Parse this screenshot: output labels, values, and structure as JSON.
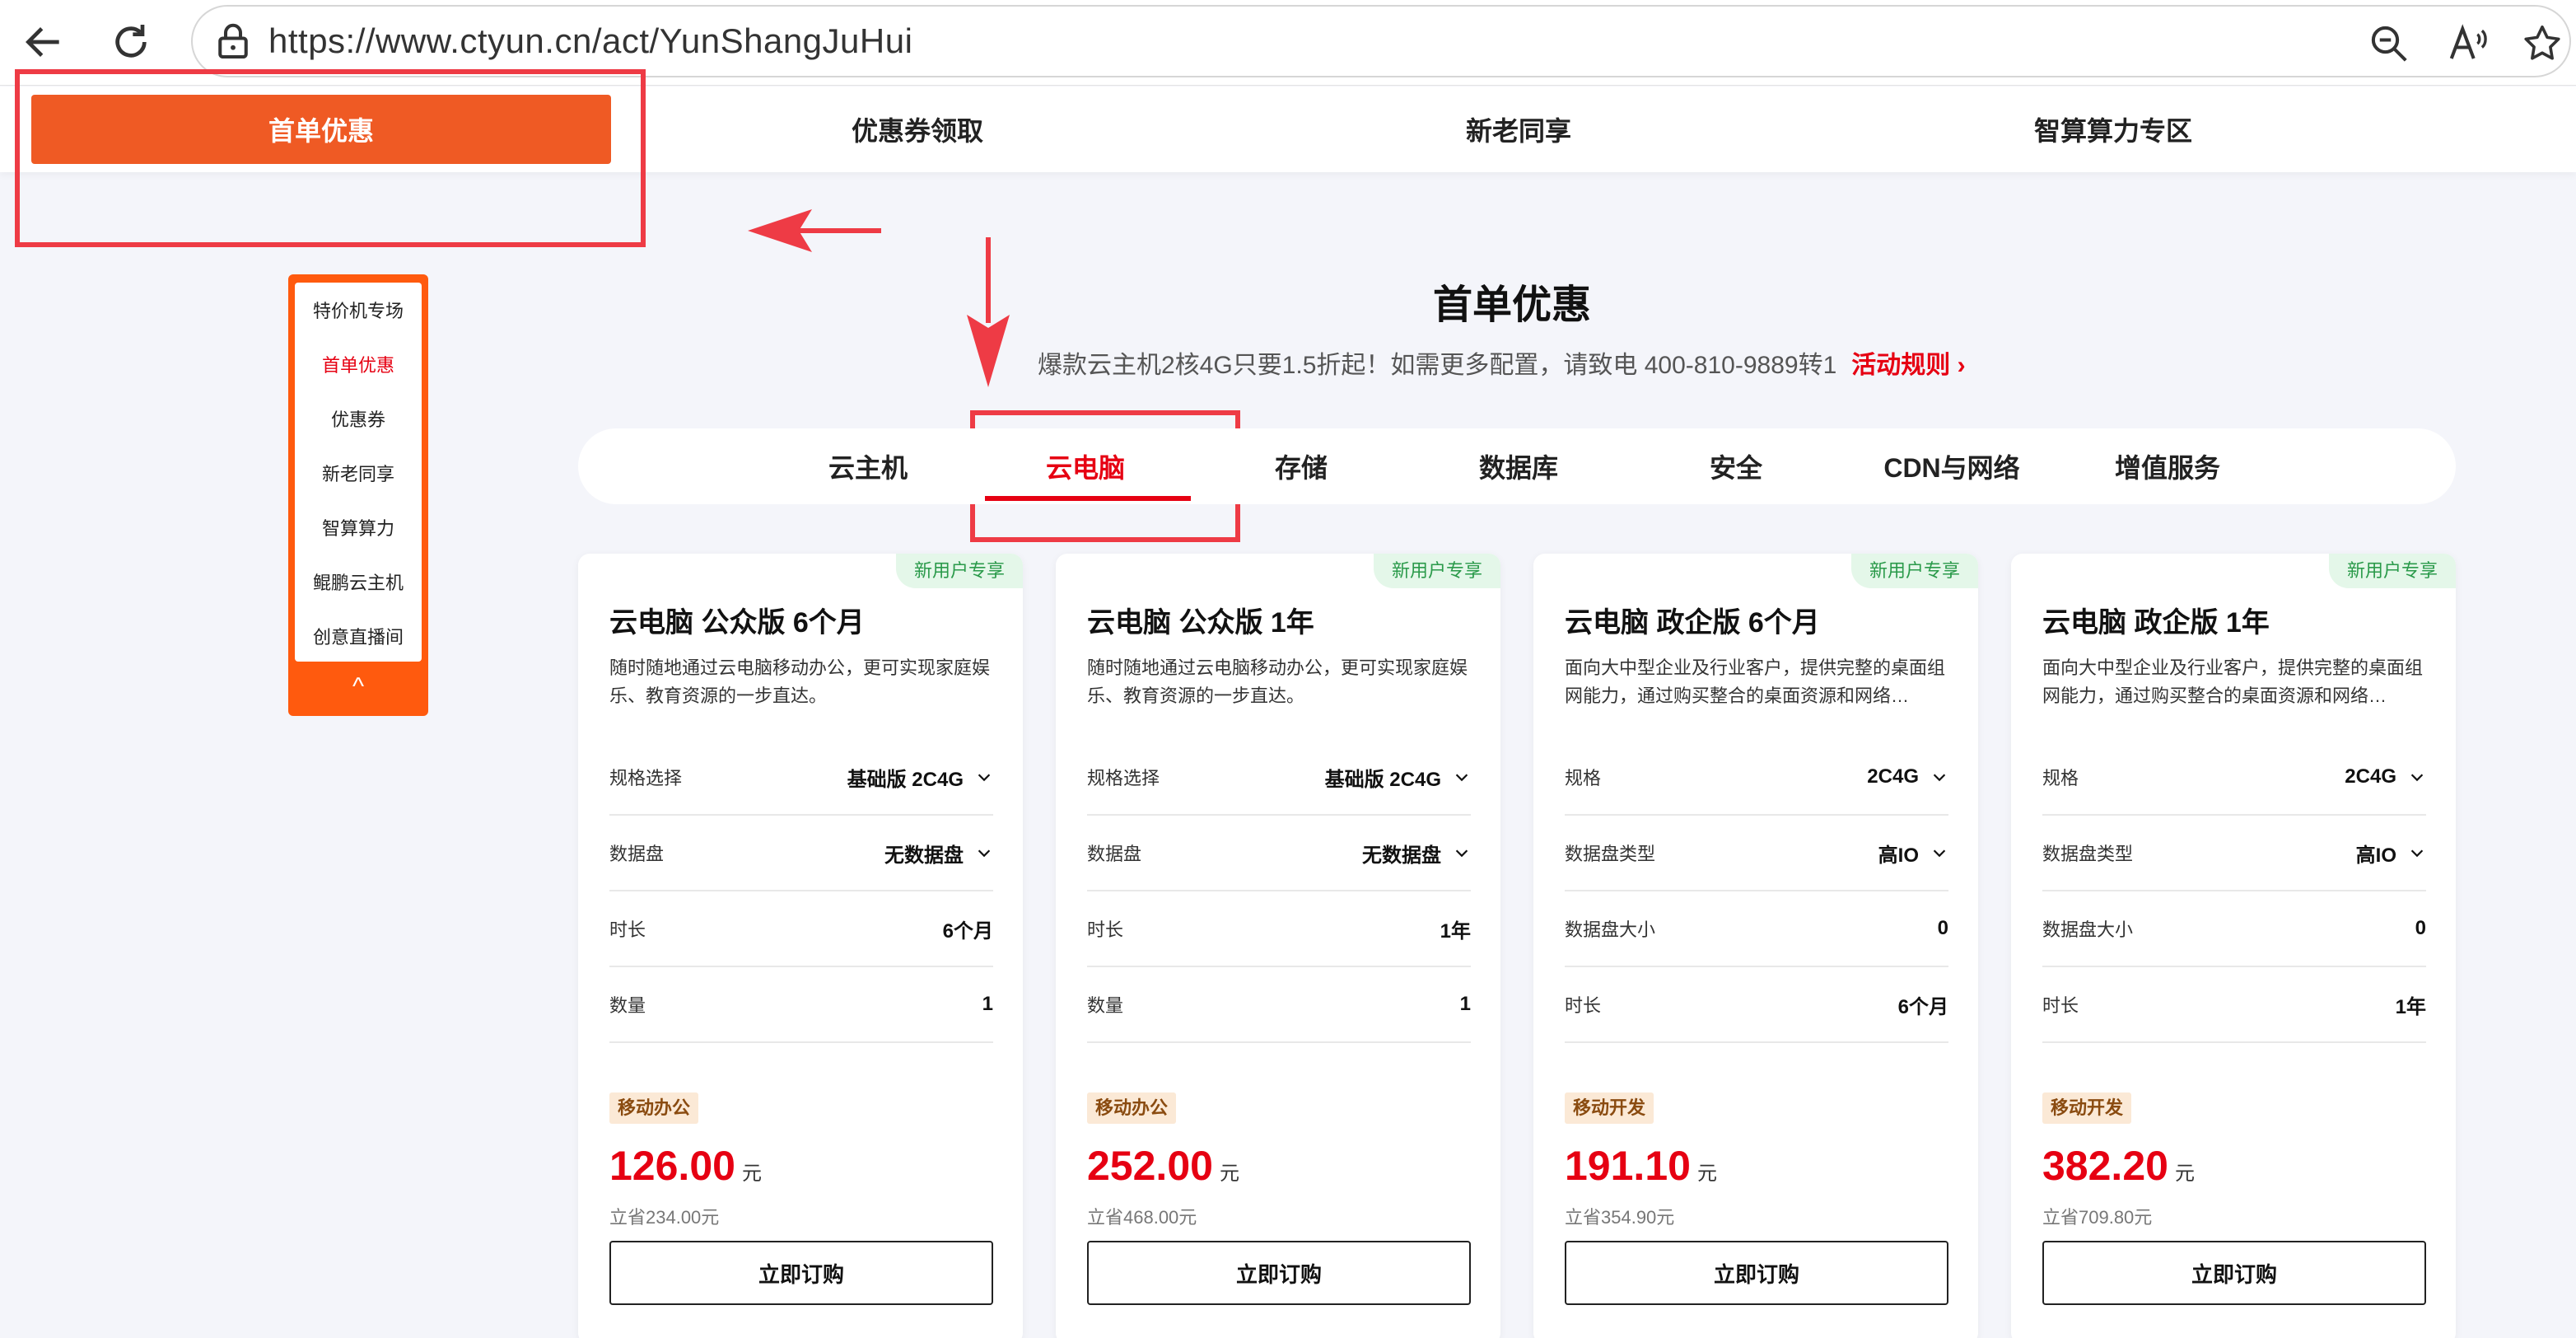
{
  "browser": {
    "url": "https://www.ctyun.cn/act/YunShangJuHui"
  },
  "top_nav": {
    "tabs": [
      {
        "label": "首单优惠",
        "active": true
      },
      {
        "label": "优惠券领取",
        "active": false
      },
      {
        "label": "新老同享",
        "active": false
      },
      {
        "label": "智算算力专区",
        "active": false
      }
    ]
  },
  "side_nav": {
    "items": [
      {
        "label": "特价机专场",
        "active": false
      },
      {
        "label": "首单优惠",
        "active": true
      },
      {
        "label": "优惠券",
        "active": false
      },
      {
        "label": "新老同享",
        "active": false
      },
      {
        "label": "智算算力",
        "active": false
      },
      {
        "label": "鲲鹏云主机",
        "active": false
      },
      {
        "label": "创意直播间",
        "active": false
      }
    ],
    "up_glyph": "^"
  },
  "section": {
    "title": "首单优惠",
    "subtitle": "爆款云主机2核4G只要1.5折起！如需更多配置，请致电 400-810-9889转1",
    "rules_link": "活动规则 ›"
  },
  "category_tabs": [
    {
      "label": "云主机",
      "active": false
    },
    {
      "label": "云电脑",
      "active": true
    },
    {
      "label": "存储",
      "active": false
    },
    {
      "label": "数据库",
      "active": false
    },
    {
      "label": "安全",
      "active": false
    },
    {
      "label": "CDN与网络",
      "active": false
    },
    {
      "label": "增值服务",
      "active": false
    }
  ],
  "cards": [
    {
      "badge": "新用户专享",
      "title": "云电脑 公众版 6个月",
      "description": "随时随地通过云电脑移动办公，更可实现家庭娱乐、教育资源的一步直达。",
      "specs": [
        {
          "label": "规格选择",
          "value": "基础版 2C4G",
          "dropdown": true
        },
        {
          "label": "数据盘",
          "value": "无数据盘",
          "dropdown": true
        },
        {
          "label": "时长",
          "value": "6个月",
          "dropdown": false
        },
        {
          "label": "数量",
          "value": "1",
          "dropdown": false
        }
      ],
      "tag": "移动办公",
      "price": "126.00",
      "price_unit": "元",
      "saving": "立省234.00元",
      "button": "立即订购"
    },
    {
      "badge": "新用户专享",
      "title": "云电脑 公众版 1年",
      "description": "随时随地通过云电脑移动办公，更可实现家庭娱乐、教育资源的一步直达。",
      "specs": [
        {
          "label": "规格选择",
          "value": "基础版 2C4G",
          "dropdown": true
        },
        {
          "label": "数据盘",
          "value": "无数据盘",
          "dropdown": true
        },
        {
          "label": "时长",
          "value": "1年",
          "dropdown": false
        },
        {
          "label": "数量",
          "value": "1",
          "dropdown": false
        }
      ],
      "tag": "移动办公",
      "price": "252.00",
      "price_unit": "元",
      "saving": "立省468.00元",
      "button": "立即订购"
    },
    {
      "badge": "新用户专享",
      "title": "云电脑 政企版 6个月",
      "description": "面向大中型企业及行业客户，提供完整的桌面组网能力，通过购买整合的桌面资源和网络…",
      "specs": [
        {
          "label": "规格",
          "value": "2C4G",
          "dropdown": true
        },
        {
          "label": "数据盘类型",
          "value": "高IO",
          "dropdown": true
        },
        {
          "label": "数据盘大小",
          "value": "0",
          "dropdown": false
        },
        {
          "label": "时长",
          "value": "6个月",
          "dropdown": false
        }
      ],
      "tag": "移动开发",
      "price": "191.10",
      "price_unit": "元",
      "saving": "立省354.90元",
      "button": "立即订购"
    },
    {
      "badge": "新用户专享",
      "title": "云电脑 政企版 1年",
      "description": "面向大中型企业及行业客户，提供完整的桌面组网能力，通过购买整合的桌面资源和网络…",
      "specs": [
        {
          "label": "规格",
          "value": "2C4G",
          "dropdown": true
        },
        {
          "label": "数据盘类型",
          "value": "高IO",
          "dropdown": true
        },
        {
          "label": "数据盘大小",
          "value": "0",
          "dropdown": false
        },
        {
          "label": "时长",
          "value": "1年",
          "dropdown": false
        }
      ],
      "tag": "移动开发",
      "price": "382.20",
      "price_unit": "元",
      "saving": "立省709.80元",
      "button": "立即订购"
    }
  ],
  "colors": {
    "brand_orange": "#ef5a24",
    "accent_red": "#e60012",
    "annotation_red": "#ee3b45",
    "badge_green": "#2a9a4a"
  }
}
